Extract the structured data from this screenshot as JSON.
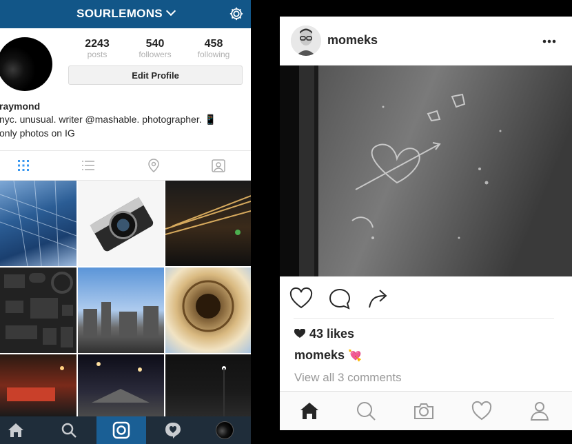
{
  "left": {
    "header": {
      "username": "SOURLEMONS",
      "accent": "#125688"
    },
    "stats": [
      {
        "value": "2243",
        "label": "posts"
      },
      {
        "value": "540",
        "label": "followers"
      },
      {
        "value": "458",
        "label": "following"
      }
    ],
    "edit_profile_label": "Edit Profile",
    "bio": {
      "name": "raymond",
      "line1": "nyc. unusual. writer @mashable. photographer. 📱",
      "line2": "only photos on IG"
    },
    "tabs": [
      "grid-view-icon",
      "list-view-icon",
      "location-pin-icon",
      "tagged-photos-icon"
    ],
    "bottom_nav": [
      "home-icon",
      "search-icon",
      "camera-icon",
      "activity-icon",
      "profile-icon"
    ]
  },
  "right": {
    "post": {
      "username": "momeks",
      "likes": "43 likes",
      "caption_user": "momeks",
      "caption_emoji": "💘",
      "comments_link": "View all 3 comments"
    },
    "actions": [
      "like-heart-icon",
      "comment-bubble-icon",
      "share-arrow-icon"
    ],
    "bottom_nav": [
      "home-icon",
      "search-icon",
      "camera-icon",
      "activity-heart-icon",
      "profile-icon"
    ]
  }
}
